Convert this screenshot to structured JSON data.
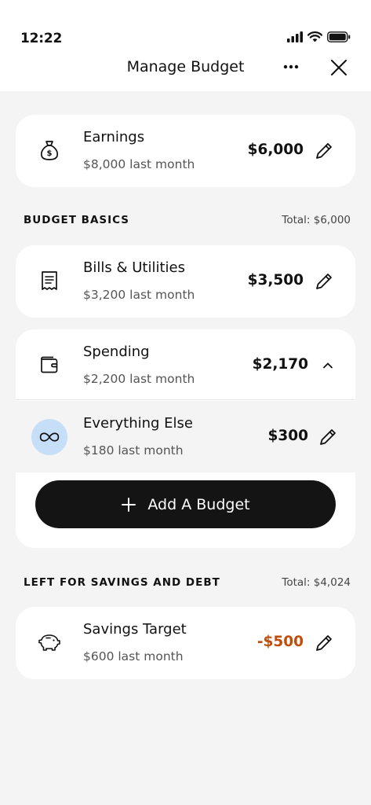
{
  "status_bar": {
    "time": "12:22"
  },
  "header": {
    "title": "Manage Budget"
  },
  "earnings": {
    "title": "Earnings",
    "subtitle": "$8,000 last month",
    "amount": "$6,000"
  },
  "budget_basics": {
    "label": "BUDGET BASICS",
    "total": "Total: $6,000",
    "bills": {
      "title": "Bills & Utilities",
      "subtitle": "$3,200 last month",
      "amount": "$3,500"
    },
    "spending": {
      "title": "Spending",
      "subtitle": "$2,200 last month",
      "amount": "$2,170",
      "items": [
        {
          "title": "Everything Else",
          "subtitle": "$180 last month",
          "amount": "$300"
        }
      ],
      "add_button_label": "Add A Budget"
    }
  },
  "savings_section": {
    "label": "LEFT FOR SAVINGS AND DEBT",
    "total": "Total: $4,024",
    "savings_target": {
      "title": "Savings Target",
      "subtitle": "$600 last month",
      "amount": "-$500"
    }
  },
  "colors": {
    "negative_amount": "#c24d0a",
    "accent_badge": "#c7def9",
    "primary_button": "#141414",
    "background": "#f4f4f4"
  }
}
